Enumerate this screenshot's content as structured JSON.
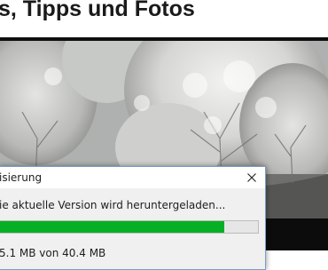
{
  "page": {
    "heading": "s, Tipps und Fotos"
  },
  "photo": {
    "description_icon": "frosted-trees-photo"
  },
  "dialog": {
    "title": "isierung",
    "close_icon": "close-icon",
    "status": "ie aktuelle Version wird heruntergeladen...",
    "progress_fraction": 0.87,
    "size_text": "5.1 MB von 40.4 MB",
    "colors": {
      "progress": "#06b025",
      "border": "#7a9cc6"
    }
  }
}
